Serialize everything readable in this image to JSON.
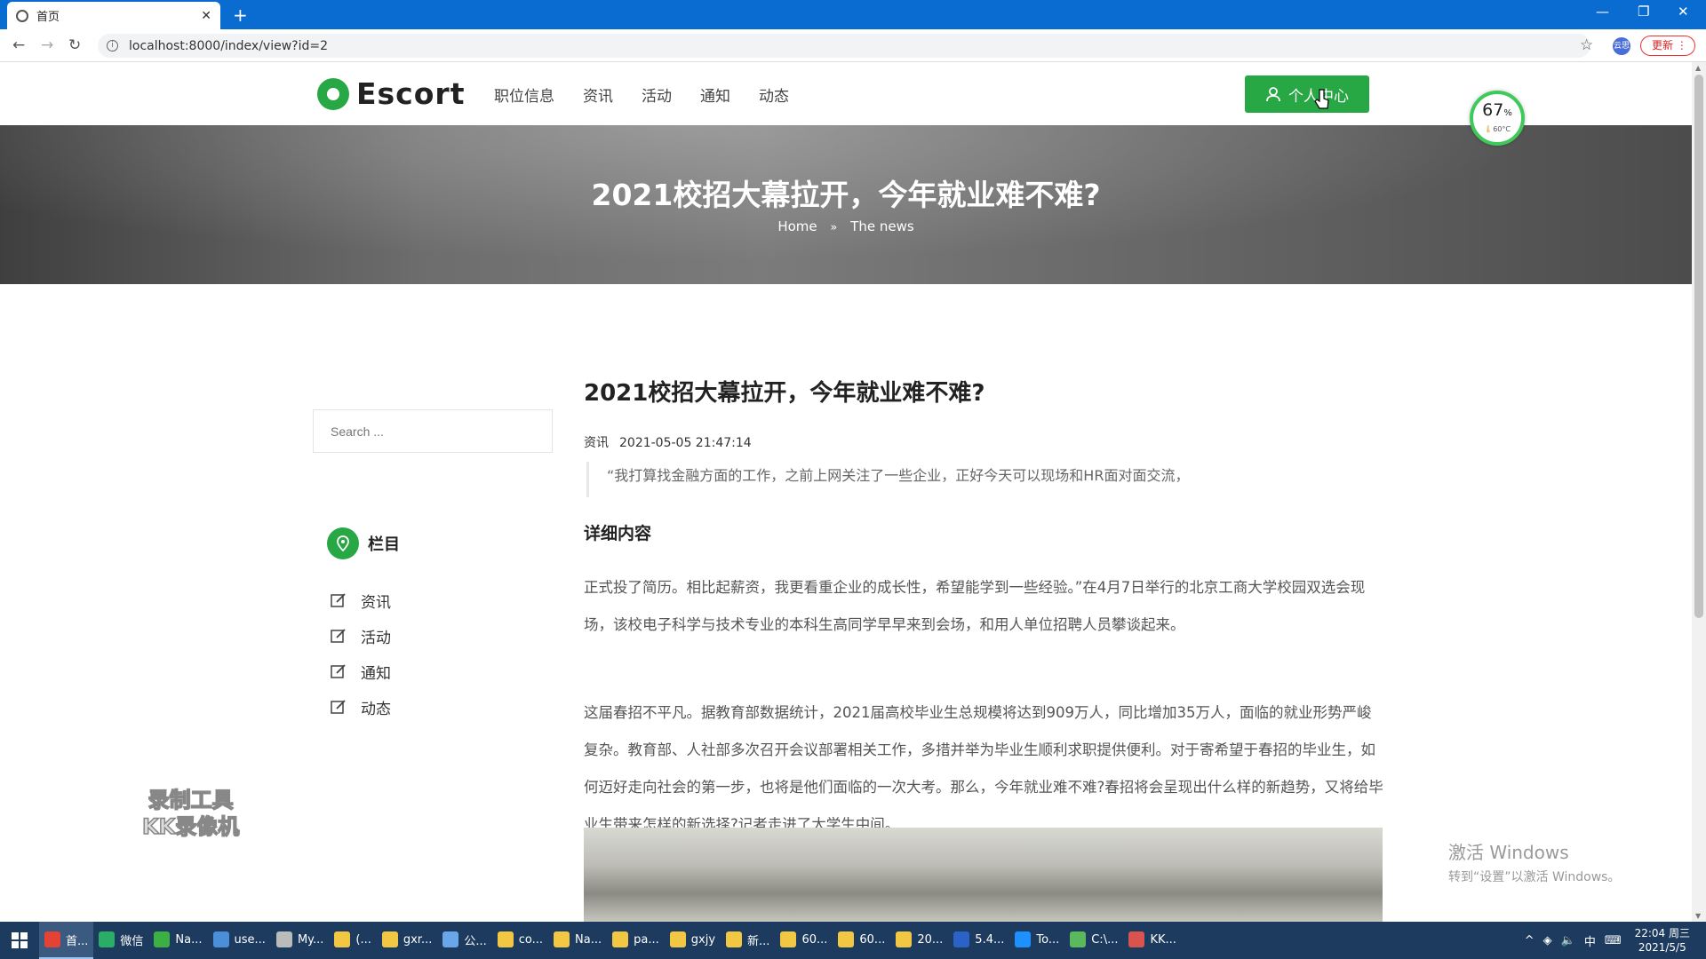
{
  "browser": {
    "tab_title": "首页",
    "url": "localhost:8000/index/view?id=2",
    "update_label": "更新",
    "profile_label": "云思"
  },
  "site": {
    "logo": "Escort",
    "nav": [
      "职位信息",
      "资讯",
      "活动",
      "通知",
      "动态"
    ],
    "personal_center": "个人中心",
    "brand_color": "#28a745"
  },
  "hero": {
    "title": "2021校招大幕拉开，今年就业难不难?",
    "breadcrumb_home": "Home",
    "breadcrumb_current": "The news"
  },
  "badge": {
    "percent": "67",
    "unit": "%",
    "temp": "60°C"
  },
  "sidebar": {
    "search_placeholder": "Search ...",
    "category_title": "栏目",
    "categories": [
      "资讯",
      "活动",
      "通知",
      "动态"
    ]
  },
  "article": {
    "title": "2021校招大幕拉开，今年就业难不难?",
    "category": "资讯",
    "date": "2021-05-05 21:47:14",
    "quote": "“我打算找金融方面的工作，之前上网关注了一些企业，正好今天可以现场和HR面对面交流，",
    "detail_heading": "详细内容",
    "para1": "正式投了简历。相比起薪资，我更看重企业的成长性，希望能学到一些经验。”在4月7日举行的北京工商大学校园双选会现场，该校电子科学与技术专业的本科生高同学早早来到会场，和用人单位招聘人员攀谈起来。",
    "para2": "这届春招不平凡。据教育部数据统计，2021届高校毕业生总规模将达到909万人，同比增加35万人，面临的就业形势严峻复杂。教育部、人社部多次召开会议部署相关工作，多措并举为毕业生顺利求职提供便利。对于寄希望于春招的毕业生，如何迈好走向社会的第一步，也将是他们面临的一次大考。那么，今年就业难不难?春招将会呈现出什么样的新趋势，又将给毕业生带来怎样的新选择?记者走进了大学生中间。"
  },
  "overlay": {
    "recorder_line1": "录制工具",
    "recorder_line2": "KK录像机",
    "activate_line1": "激活 Windows",
    "activate_line2": "转到“设置”以激活 Windows。"
  },
  "taskbar": {
    "items": [
      {
        "label": "首...",
        "color": "#e34234",
        "active": true
      },
      {
        "label": "微信",
        "color": "#2aae67",
        "active": false
      },
      {
        "label": "Na...",
        "color": "#3cb043",
        "active": false
      },
      {
        "label": "use...",
        "color": "#4a8fd8",
        "active": false
      },
      {
        "label": "My...",
        "color": "#bbbbbb",
        "active": false
      },
      {
        "label": "(...",
        "color": "#f2c744",
        "active": false
      },
      {
        "label": "gxr...",
        "color": "#f2c744",
        "active": false
      },
      {
        "label": "公...",
        "color": "#6aa7e8",
        "active": false
      },
      {
        "label": "co...",
        "color": "#f2c744",
        "active": false
      },
      {
        "label": "Na...",
        "color": "#f2c744",
        "active": false
      },
      {
        "label": "pa...",
        "color": "#f2c744",
        "active": false
      },
      {
        "label": "gxjy",
        "color": "#f2c744",
        "active": false
      },
      {
        "label": "新...",
        "color": "#f2c744",
        "active": false
      },
      {
        "label": "60...",
        "color": "#f2c744",
        "active": false
      },
      {
        "label": "60...",
        "color": "#f2c744",
        "active": false
      },
      {
        "label": "20...",
        "color": "#f2c744",
        "active": false
      },
      {
        "label": "5.4...",
        "color": "#2b62c7",
        "active": false
      },
      {
        "label": "To...",
        "color": "#1e90ff",
        "active": false
      },
      {
        "label": "C:\\...",
        "color": "#5cb85c",
        "active": false
      },
      {
        "label": "KK...",
        "color": "#d9534f",
        "active": false
      }
    ],
    "ime": "中",
    "time": "22:04 周三",
    "date": "2021/5/5"
  }
}
